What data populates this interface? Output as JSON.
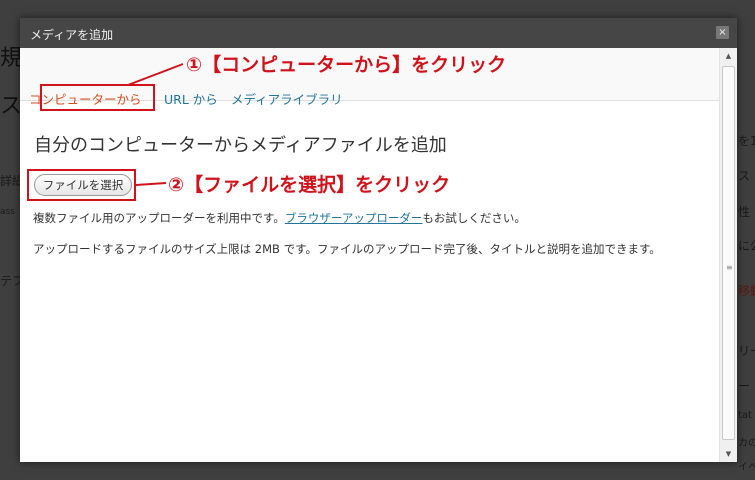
{
  "background": {
    "left_fragments": [
      "規",
      "ス",
      "詳細",
      "ass",
      "テフ"
    ],
    "right_fragments": [
      "を1",
      "ス",
      "性 :",
      "に公",
      "移動",
      "リー",
      "ー",
      "tat",
      "カの",
      "イベ"
    ]
  },
  "modal": {
    "title": "メディアを追加",
    "close_glyph": "×",
    "tabs": [
      {
        "label": "コンピューターから"
      },
      {
        "label": "URL から"
      },
      {
        "label": "メディアライブラリ"
      }
    ],
    "heading": "自分のコンピューターからメディアファイルを追加",
    "file_button_label": "ファイルを選択",
    "para1_before": "複数ファイル用のアップローダーを利用中です。",
    "para1_link": "ブラウザーアップローダー",
    "para1_after": "もお試しください。",
    "para2": "アップロードするファイルのサイズ上限は 2MB です。ファイルのアップロード完了後、タイトルと説明を追加できます。"
  },
  "annotations": {
    "step1": "①【コンピューターから】をクリック",
    "step2": "②【ファイルを選択】をクリック",
    "color": "#d0121b"
  },
  "icons": {
    "scroll_up": "▲",
    "scroll_down": "▼",
    "scroll_grip": "≡"
  }
}
